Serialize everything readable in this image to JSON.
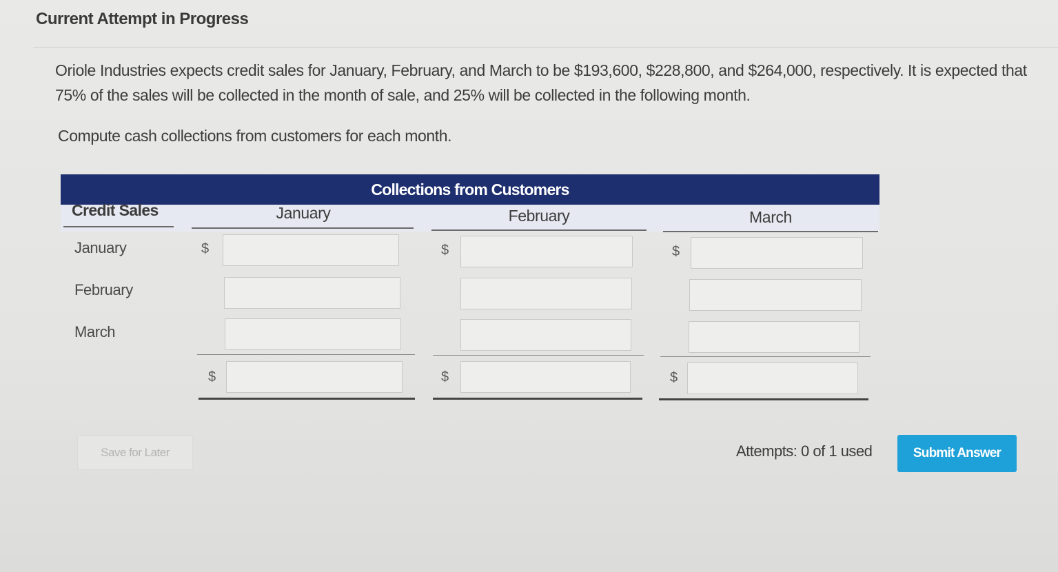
{
  "header": {
    "title": "Current Attempt in Progress"
  },
  "question": {
    "text": "Oriole Industries expects credit sales for January, February, and March to be $193,600, $228,800, and $264,000, respectively. It is expected that 75% of the sales will be collected in the month of sale, and 25% will be collected in the following month.",
    "instruction": "Compute cash collections from customers for each month."
  },
  "table": {
    "title": "Collections from Customers",
    "credit_sales_label": "Credit Sales",
    "columns": [
      "January",
      "February",
      "March"
    ],
    "rows": [
      "January",
      "February",
      "March"
    ],
    "currency": "$",
    "inputs": {
      "jan_jan": "",
      "jan_feb": "",
      "jan_mar": "",
      "feb_jan": "",
      "feb_feb": "",
      "feb_mar": "",
      "mar_jan": "",
      "mar_feb": "",
      "mar_mar": "",
      "total_jan": "",
      "total_feb": "",
      "total_mar": ""
    }
  },
  "footer": {
    "save_label": "Save for Later",
    "attempts_text": "Attempts: 0 of 1 used",
    "submit_label": "Submit Answer"
  },
  "colors": {
    "table_header": "#1e2f6f",
    "submit_button": "#1ea0d8"
  }
}
